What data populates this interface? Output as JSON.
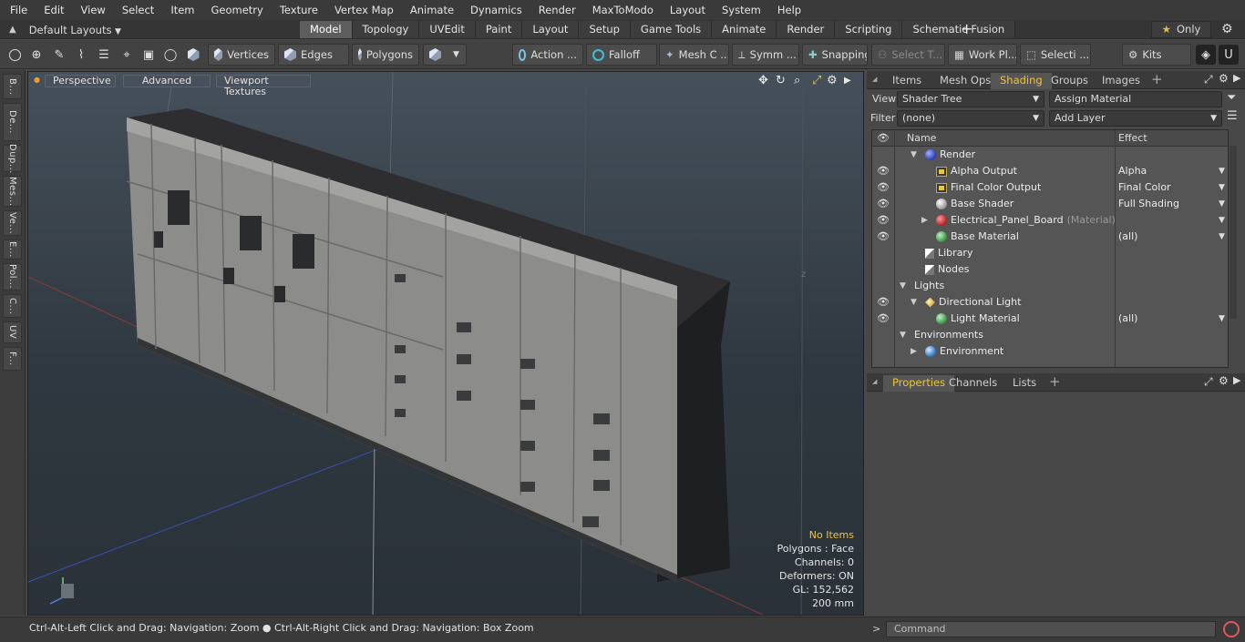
{
  "menu": [
    "File",
    "Edit",
    "View",
    "Select",
    "Item",
    "Geometry",
    "Texture",
    "Vertex Map",
    "Animate",
    "Dynamics",
    "Render",
    "MaxToModo",
    "Layout",
    "System",
    "Help"
  ],
  "layout_dropdown": "Default Layouts",
  "tabs": [
    {
      "label": "Model",
      "active": true
    },
    {
      "label": "Topology",
      "active": false
    },
    {
      "label": "UVEdit",
      "active": false
    },
    {
      "label": "Paint",
      "active": false
    },
    {
      "label": "Layout",
      "active": false
    },
    {
      "label": "Setup",
      "active": false
    },
    {
      "label": "Game Tools",
      "active": false
    },
    {
      "label": "Animate",
      "active": false
    },
    {
      "label": "Render",
      "active": false
    },
    {
      "label": "Scripting",
      "active": false
    },
    {
      "label": "Schematic Fusion",
      "active": false
    }
  ],
  "only_label": "Only",
  "toolbar": {
    "vertices": "Vertices",
    "edges": "Edges",
    "polygons": "Polygons",
    "action": "Action ...",
    "falloff": "Falloff",
    "mesh": "Mesh C ...",
    "symm": "Symm ...",
    "snapping": "Snapping",
    "select_t": "Select T...",
    "work_pl": "Work Pl...",
    "selecti": "Selecti ...",
    "kits": "Kits"
  },
  "left_tabs": [
    "B...",
    "De...",
    "Dup...",
    "Mes...",
    "Ve...",
    "E...",
    "Pol...",
    "C...",
    "UV",
    "F..."
  ],
  "viewport": {
    "perspective": "Perspective",
    "advanced": "Advanced",
    "textures": "Viewport Textures",
    "info": {
      "items": "No Items",
      "polygons": "Polygons : Face",
      "channels": "Channels: 0",
      "deformers": "Deformers: ON",
      "gl": "GL: 152,562",
      "scale": "200 mm"
    }
  },
  "right_tabs": [
    "Items",
    "Mesh Ops",
    "Shading",
    "Groups",
    "Images"
  ],
  "right_active": "Shading",
  "shading": {
    "view_label": "View",
    "view_value": "Shader Tree",
    "assign_material": "Assign Material",
    "filter_label": "Filter",
    "filter_value": "(none)",
    "add_layer": "Add Layer",
    "col_name": "Name",
    "col_effect": "Effect"
  },
  "tree": [
    {
      "label": "Render",
      "icon": "blue",
      "indent": 1,
      "eye": false,
      "effect": "",
      "twirl": "open"
    },
    {
      "label": "Alpha Output",
      "icon": "image",
      "indent": 2,
      "eye": true,
      "effect": "Alpha",
      "twirl": ""
    },
    {
      "label": "Final Color Output",
      "icon": "image",
      "indent": 2,
      "eye": true,
      "effect": "Final Color",
      "twirl": ""
    },
    {
      "label": "Base Shader",
      "icon": "white",
      "indent": 2,
      "eye": true,
      "effect": "Full Shading",
      "twirl": ""
    },
    {
      "label": "Electrical_Panel_Board",
      "suffix": "(Material)",
      "icon": "red",
      "indent": 2,
      "eye": true,
      "effect": "",
      "twirl": "closed"
    },
    {
      "label": "Base Material",
      "icon": "green",
      "indent": 2,
      "eye": true,
      "effect": "(all)",
      "twirl": ""
    },
    {
      "label": "Library",
      "icon": "flag",
      "indent": 1,
      "eye": false,
      "effect": "",
      "twirl": ""
    },
    {
      "label": "Nodes",
      "icon": "flag",
      "indent": 1,
      "eye": false,
      "effect": "",
      "twirl": ""
    },
    {
      "label": "Lights",
      "icon": "none",
      "indent": 0,
      "eye": false,
      "effect": "",
      "twirl": "open"
    },
    {
      "label": "Directional Light",
      "icon": "lamp",
      "indent": 1,
      "eye": true,
      "effect": "",
      "twirl": "open"
    },
    {
      "label": "Light Material",
      "icon": "green",
      "indent": 2,
      "eye": true,
      "effect": "(all)",
      "twirl": ""
    },
    {
      "label": "Environments",
      "icon": "none",
      "indent": 0,
      "eye": false,
      "effect": "",
      "twirl": "open"
    },
    {
      "label": "Environment",
      "icon": "env",
      "indent": 1,
      "eye": false,
      "effect": "",
      "twirl": "closed"
    }
  ],
  "prop_tabs": [
    "Properties",
    "Channels",
    "Lists"
  ],
  "status": "Ctrl-Alt-Left Click and Drag: Navigation: Zoom ● Ctrl-Alt-Right Click and Drag: Navigation: Box Zoom",
  "command_placeholder": "Command"
}
